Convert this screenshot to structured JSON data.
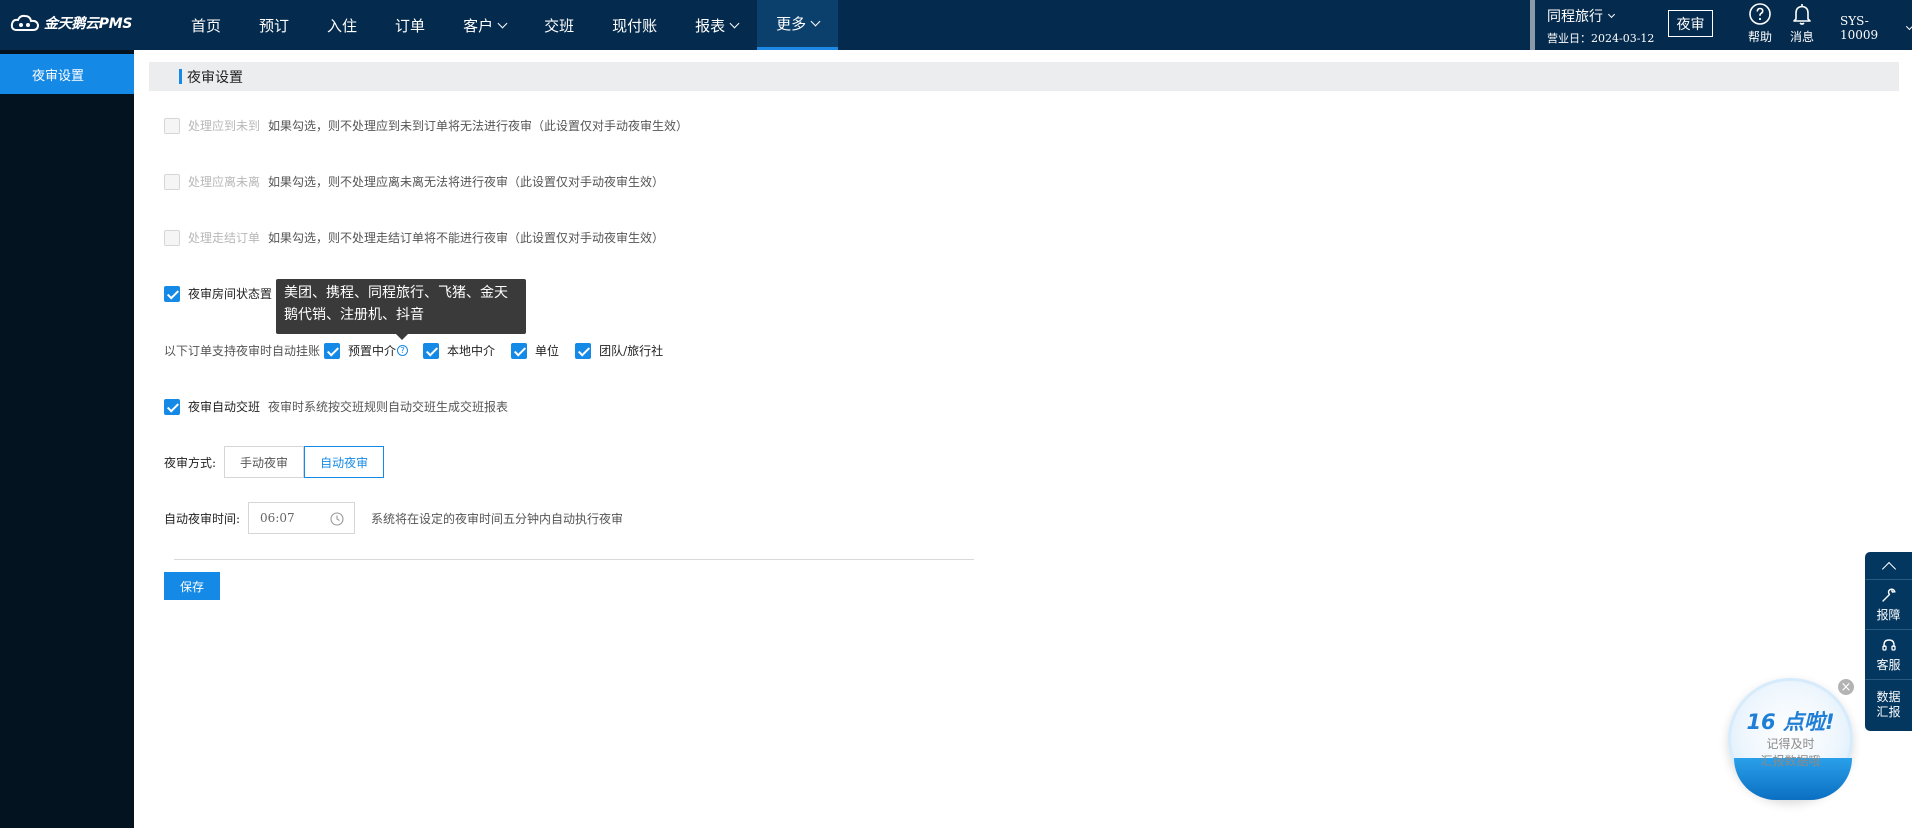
{
  "topbar": {
    "logo_text": "金天鹅云PMS",
    "nav": [
      {
        "label": "首页",
        "dropdown": false,
        "active": false
      },
      {
        "label": "预订",
        "dropdown": false,
        "active": false
      },
      {
        "label": "入住",
        "dropdown": false,
        "active": false
      },
      {
        "label": "订单",
        "dropdown": false,
        "active": false
      },
      {
        "label": "客户",
        "dropdown": true,
        "active": false
      },
      {
        "label": "交班",
        "dropdown": false,
        "active": false
      },
      {
        "label": "现付账",
        "dropdown": false,
        "active": false
      },
      {
        "label": "报表",
        "dropdown": true,
        "active": false
      },
      {
        "label": "更多",
        "dropdown": true,
        "active": true
      }
    ],
    "hotel_name": "同程旅行",
    "business_date": "营业日：2024-03-12",
    "night_audit_button": "夜审",
    "help_label": "帮助",
    "message_label": "消息",
    "user": "SYS-10009"
  },
  "sidebar": {
    "items": [
      {
        "label": "夜审设置",
        "active": true
      }
    ]
  },
  "main": {
    "section_title": "夜审设置",
    "options": [
      {
        "label": "处理应到未到",
        "hint": "如果勾选，则不处理应到未到订单将无法进行夜审（此设置仅对手动夜审生效）",
        "checked": false,
        "disabled": true
      },
      {
        "label": "处理应离未离",
        "hint": "如果勾选，则不处理应离未离无法将进行夜审（此设置仅对手动夜审生效）",
        "checked": false,
        "disabled": true
      },
      {
        "label": "处理走结订单",
        "hint": "如果勾选，则不处理走结订单将不能进行夜审（此设置仅对手动夜审生效）",
        "checked": false,
        "disabled": true
      },
      {
        "label": "夜审房间状态置",
        "hint": "",
        "checked": true,
        "disabled": false
      }
    ],
    "tooltip": "美团、携程、同程旅行、飞猪、金天鹅代销、注册机、抖音",
    "auto_charge": {
      "label": "以下订单支持夜审时自动挂账",
      "items": [
        {
          "label": "预置中介",
          "checked": true,
          "help": true
        },
        {
          "label": "本地中介",
          "checked": true,
          "help": false
        },
        {
          "label": "单位",
          "checked": true,
          "help": false
        },
        {
          "label": "团队/旅行社",
          "checked": true,
          "help": false
        }
      ]
    },
    "auto_shift": {
      "label": "夜审自动交班",
      "hint": "夜审时系统按交班规则自动交班生成交班报表",
      "checked": true
    },
    "audit_mode": {
      "label": "夜审方式:",
      "options": [
        "手动夜审",
        "自动夜审"
      ],
      "selected": "自动夜审"
    },
    "auto_time": {
      "label": "自动夜审时间:",
      "value": "06:07",
      "hint": "系统将在设定的夜审时间五分钟内自动执行夜审"
    },
    "save_label": "保存"
  },
  "float_toolbar": {
    "items": [
      "报障",
      "客服",
      "数据汇报"
    ]
  },
  "reminder": {
    "title": "16 点啦!",
    "line1": "记得及时",
    "line2": "汇报数据哦"
  }
}
